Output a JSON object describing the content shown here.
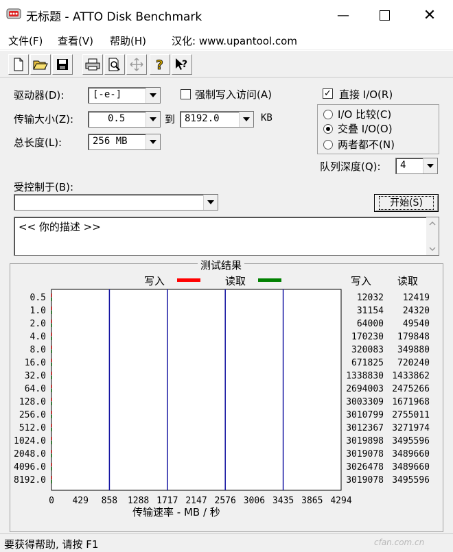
{
  "window": {
    "title": "无标题 - ATTO Disk Benchmark"
  },
  "menu": [
    "文件(F)",
    "查看(V)",
    "帮助(H)",
    "汉化: www.upantool.com"
  ],
  "toolbar": [
    "new-icon",
    "open-icon",
    "save-icon",
    "print-icon",
    "preview-icon",
    "move-icon",
    "help-icon",
    "context-help-icon"
  ],
  "form": {
    "drive_label": "驱动器(D):",
    "drive_value": "[-e-]",
    "force_write_label": "强制写入访问(A)",
    "force_write_checked": false,
    "direct_io_label": "直接 I/O(R)",
    "direct_io_checked": true,
    "transfer_label": "传输大小(Z):",
    "transfer_from": "0.5",
    "transfer_to_label": "到",
    "transfer_to": "8192.0",
    "transfer_unit": "KB",
    "length_label": "总长度(L):",
    "length_value": "256 MB",
    "io_options": [
      {
        "label": "I/O 比较(C)",
        "selected": false
      },
      {
        "label": "交叠 I/O(O)",
        "selected": true
      },
      {
        "label": "两者都不(N)",
        "selected": false
      }
    ],
    "queue_label": "队列深度(Q):",
    "queue_value": "4",
    "controlled_label": "受控制于(B):",
    "controlled_value": "",
    "start_label": "开始(S)",
    "description": "<<  你的描述   >>"
  },
  "results": {
    "title": "测试结果",
    "legend_write": "写入",
    "legend_read": "读取",
    "col_write": "写入",
    "col_read": "读取",
    "xlabel": "传输速率 - MB / 秒",
    "write_color": "#ff0000",
    "read_color": "#008000"
  },
  "chart_data": {
    "type": "bar",
    "categories": [
      "0.5",
      "1.0",
      "2.0",
      "4.0",
      "8.0",
      "16.0",
      "32.0",
      "64.0",
      "128.0",
      "256.0",
      "512.0",
      "1024.0",
      "2048.0",
      "4096.0",
      "8192.0"
    ],
    "series": [
      {
        "name": "写入",
        "values": [
          12032,
          31154,
          64000,
          170230,
          320083,
          671825,
          1338830,
          2694003,
          3003309,
          3010799,
          3012367,
          3019898,
          3019078,
          3026478,
          3019078
        ]
      },
      {
        "name": "读取",
        "values": [
          12419,
          24320,
          49540,
          179848,
          349880,
          720240,
          1433862,
          2475266,
          1671968,
          2755011,
          3271974,
          3495596,
          3489660,
          3489660,
          3495596
        ]
      }
    ],
    "xticks": [
      "0",
      "429",
      "858",
      "1288",
      "1717",
      "2147",
      "2576",
      "3006",
      "3435",
      "3865",
      "4294"
    ],
    "xlim": [
      0,
      4294
    ],
    "xlabel": "传输速率 - MB / 秒",
    "grid": true
  },
  "status": {
    "text": "要获得帮助, 请按 F1",
    "watermark": "cfan.com.cn"
  }
}
